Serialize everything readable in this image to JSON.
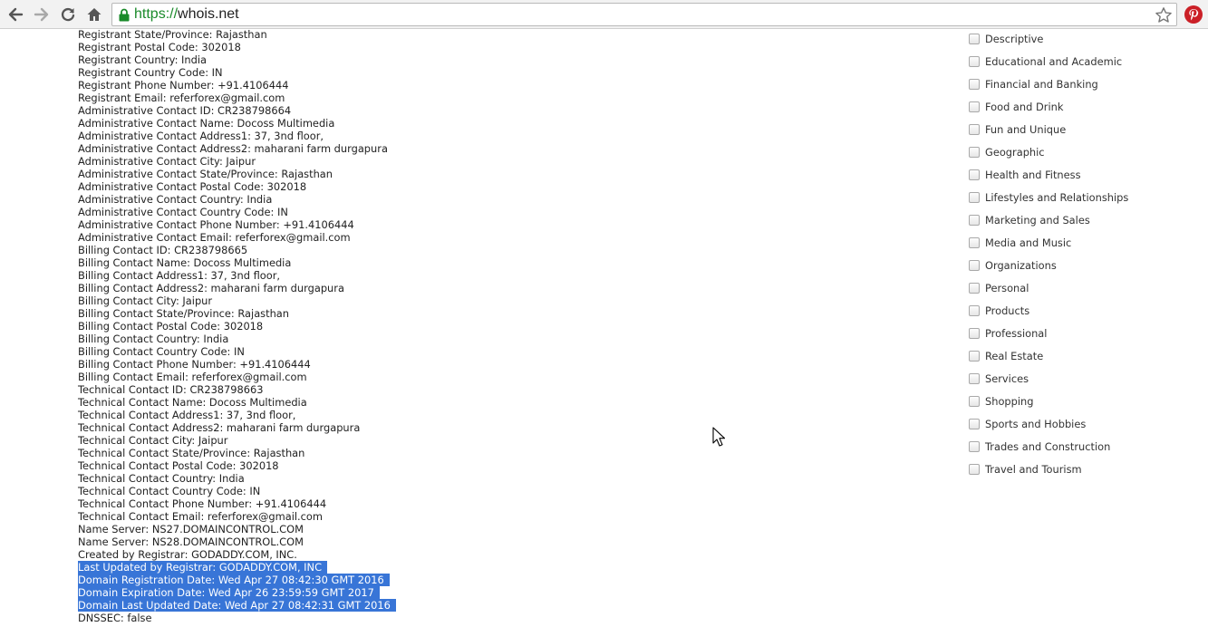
{
  "browser": {
    "url_scheme": "https://",
    "url_host": "whois.net",
    "icons": [
      "back-icon",
      "forward-icon",
      "reload-icon",
      "home-icon",
      "lock-icon",
      "bookmark-star-icon",
      "pinterest-icon"
    ]
  },
  "whois_lines": [
    "Registrant State/Province: Rajasthan",
    "Registrant Postal Code: 302018",
    "Registrant Country: India",
    "Registrant Country Code: IN",
    "Registrant Phone Number: +91.4106444",
    "Registrant Email: referforex@gmail.com",
    "Administrative Contact ID: CR238798664",
    "Administrative Contact Name: Docoss Multimedia",
    "Administrative Contact Address1: 37, 3nd floor,",
    "Administrative Contact Address2: maharani farm durgapura",
    "Administrative Contact City: Jaipur",
    "Administrative Contact State/Province: Rajasthan",
    "Administrative Contact Postal Code: 302018",
    "Administrative Contact Country: India",
    "Administrative Contact Country Code: IN",
    "Administrative Contact Phone Number: +91.4106444",
    "Administrative Contact Email: referforex@gmail.com",
    "Billing Contact ID: CR238798665",
    "Billing Contact Name: Docoss Multimedia",
    "Billing Contact Address1: 37, 3nd floor,",
    "Billing Contact Address2: maharani farm durgapura",
    "Billing Contact City: Jaipur",
    "Billing Contact State/Province: Rajasthan",
    "Billing Contact Postal Code: 302018",
    "Billing Contact Country: India",
    "Billing Contact Country Code: IN",
    "Billing Contact Phone Number: +91.4106444",
    "Billing Contact Email: referforex@gmail.com",
    "Technical Contact ID: CR238798663",
    "Technical Contact Name: Docoss Multimedia",
    "Technical Contact Address1: 37, 3nd floor,",
    "Technical Contact Address2: maharani farm durgapura",
    "Technical Contact City: Jaipur",
    "Technical Contact State/Province: Rajasthan",
    "Technical Contact Postal Code: 302018",
    "Technical Contact Country: India",
    "Technical Contact Country Code: IN",
    "Technical Contact Phone Number: +91.4106444",
    "Technical Contact Email: referforex@gmail.com",
    "Name Server: NS27.DOMAINCONTROL.COM",
    "Name Server: NS28.DOMAINCONTROL.COM",
    "Created by Registrar: GODADDY.COM, INC.",
    "Last Updated by Registrar: GODADDY.COM, INC",
    "Domain Registration Date: Wed Apr 27 08:42:30 GMT 2016",
    "Domain Expiration Date: Wed Apr 26 23:59:59 GMT 2017",
    "Domain Last Updated Date: Wed Apr 27 08:42:31 GMT 2016",
    "DNSSEC: false"
  ],
  "selected_lines": [
    "Last Updated by Registrar: GODADDY.COM, INC",
    "Domain Registration Date: Wed Apr 27 08:42:30 GMT 2016",
    "Domain Expiration Date: Wed Apr 26 23:59:59 GMT 2017",
    "Domain Last Updated Date: Wed Apr 27 08:42:31 GMT 2016"
  ],
  "selection_color": "#3875d7",
  "categories": [
    "Descriptive",
    "Educational and Academic",
    "Financial and Banking",
    "Food and Drink",
    "Fun and Unique",
    "Geographic",
    "Health and Fitness",
    "Lifestyles and Relationships",
    "Marketing and Sales",
    "Media and Music",
    "Organizations",
    "Personal",
    "Products",
    "Professional",
    "Real Estate",
    "Services",
    "Shopping",
    "Sports and Hobbies",
    "Trades and Construction",
    "Travel and Tourism"
  ]
}
